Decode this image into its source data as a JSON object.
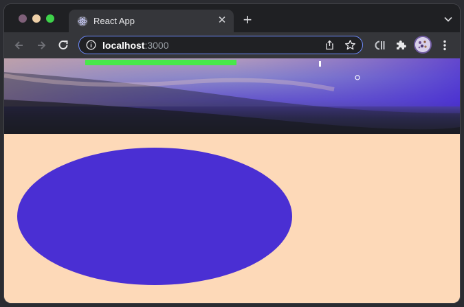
{
  "browser": {
    "tab": {
      "title": "React App",
      "favicon": "react-logo-icon"
    },
    "new_tab_icon": "plus-icon",
    "address": {
      "host": "localhost",
      "port": ":3000"
    },
    "toolbar_icons": [
      "back-arrow-icon",
      "forward-arrow-icon",
      "reload-icon",
      "info-icon",
      "share-icon",
      "star-icon",
      "extension-c-icon",
      "puzzle-icon",
      "profile-avatar",
      "kebab-menu-icon"
    ]
  },
  "colors": {
    "page_background": "#fdd9b8",
    "ellipse": "#4a2fd3",
    "green_bar": "#48e84a",
    "sky_top": "#8f8cc9",
    "sky_bottom": "#1c1d23"
  }
}
